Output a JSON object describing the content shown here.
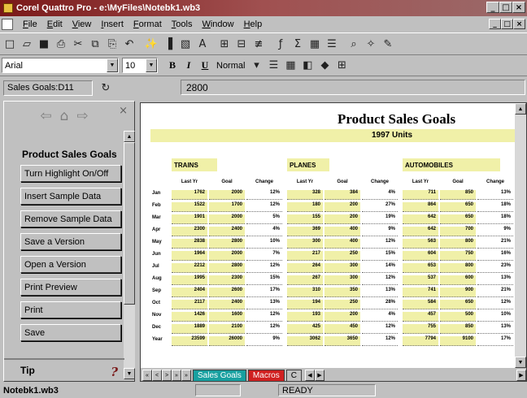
{
  "window": {
    "title": "Corel Quattro Pro - e:\\MyFiles\\Notebk1.wb3",
    "buttons": [
      "_",
      "□",
      "×"
    ]
  },
  "menubar": {
    "items": [
      "File",
      "Edit",
      "View",
      "Insert",
      "Format",
      "Tools",
      "Window",
      "Help"
    ]
  },
  "toolbar": {
    "icons": [
      "new-icon",
      "open-icon",
      "save-icon",
      "print-icon",
      "cut-icon",
      "copy-icon",
      "paste-icon",
      "undo-icon",
      "format-painter-icon",
      "chart-icon",
      "map-icon",
      "text-icon",
      "insert-icon",
      "delete-icon",
      "fit-icon",
      "function-icon",
      "sum-icon",
      "table-icon",
      "grid-icon",
      "zoom-icon",
      "experts-icon",
      "pen-icon"
    ],
    "glyphs": [
      "□",
      "▱",
      "■",
      "⎙",
      "✂",
      "⧉",
      "⎘",
      "↶",
      "✨",
      "▐",
      "▧",
      "A",
      "⊞",
      "⊟",
      "≢",
      "ƒ",
      "Σ",
      "▦",
      "☰",
      "⌕",
      "✧",
      "✎"
    ]
  },
  "format": {
    "font": "Arial",
    "size": "10",
    "bold": "B",
    "italic": "I",
    "underline": "U",
    "style": "Normal"
  },
  "input": {
    "cell_ref": "Sales Goals:D11",
    "cell_value": "2800"
  },
  "panel": {
    "heading": "Product Sales Goals",
    "buttons": [
      "Turn Highlight On/Off",
      "Insert Sample Data",
      "Remove Sample Data",
      "Save a Version",
      "Open a Version",
      "Print Preview",
      "Print",
      "Save"
    ],
    "tip_label": "Tip",
    "nav": [
      "⇦",
      "⌂",
      "⇨"
    ],
    "close": "×"
  },
  "sheet": {
    "title": "Product Sales Goals",
    "subtitle": "1997 Units",
    "sections": [
      "TRAINS",
      "PLANES",
      "AUTOMOBILES"
    ],
    "col_heads": [
      "Last Yr",
      "Goal",
      "Change",
      "Last Yr",
      "Goal",
      "Change",
      "Last Yr",
      "Goal",
      "Change"
    ],
    "rows": [
      {
        "label": "Jan",
        "values": [
          "1762",
          "2000",
          "12%",
          "328",
          "384",
          "4%",
          "711",
          "850",
          "13%"
        ]
      },
      {
        "label": "Feb",
        "values": [
          "1522",
          "1700",
          "12%",
          "180",
          "200",
          "27%",
          "864",
          "650",
          "18%"
        ]
      },
      {
        "label": "Mar",
        "values": [
          "1901",
          "2000",
          "5%",
          "155",
          "200",
          "19%",
          "642",
          "650",
          "18%"
        ]
      },
      {
        "label": "Apr",
        "values": [
          "2300",
          "2400",
          "4%",
          "369",
          "400",
          "9%",
          "642",
          "700",
          "9%"
        ]
      },
      {
        "label": "May",
        "values": [
          "2838",
          "2800",
          "10%",
          "300",
          "400",
          "12%",
          "563",
          "800",
          "21%"
        ]
      },
      {
        "label": "Jun",
        "values": [
          "1964",
          "2000",
          "7%",
          "217",
          "250",
          "15%",
          "604",
          "750",
          "16%"
        ]
      },
      {
        "label": "Jul",
        "values": [
          "2212",
          "2800",
          "12%",
          "264",
          "300",
          "14%",
          "653",
          "800",
          "23%"
        ]
      },
      {
        "label": "Aug",
        "values": [
          "1995",
          "2300",
          "15%",
          "267",
          "300",
          "12%",
          "537",
          "600",
          "13%"
        ]
      },
      {
        "label": "Sep",
        "values": [
          "2404",
          "2600",
          "17%",
          "310",
          "350",
          "13%",
          "741",
          "900",
          "21%"
        ]
      },
      {
        "label": "Oct",
        "values": [
          "2117",
          "2400",
          "13%",
          "194",
          "250",
          "28%",
          "584",
          "650",
          "12%"
        ]
      },
      {
        "label": "Nov",
        "values": [
          "1426",
          "1600",
          "12%",
          "193",
          "200",
          "4%",
          "457",
          "500",
          "10%"
        ]
      },
      {
        "label": "Dec",
        "values": [
          "1889",
          "2100",
          "12%",
          "425",
          "450",
          "12%",
          "755",
          "850",
          "13%"
        ]
      },
      {
        "label": "Year",
        "values": [
          "23599",
          "26000",
          "9%",
          "3062",
          "3650",
          "12%",
          "7794",
          "9100",
          "17%"
        ]
      }
    ],
    "tabs": [
      "Sales Goals",
      "Macros",
      "C"
    ],
    "tab_nav": [
      "«",
      "<",
      ">",
      "»",
      "»"
    ]
  },
  "status": {
    "file": "Notebk1.wb3",
    "mode": "READY"
  }
}
